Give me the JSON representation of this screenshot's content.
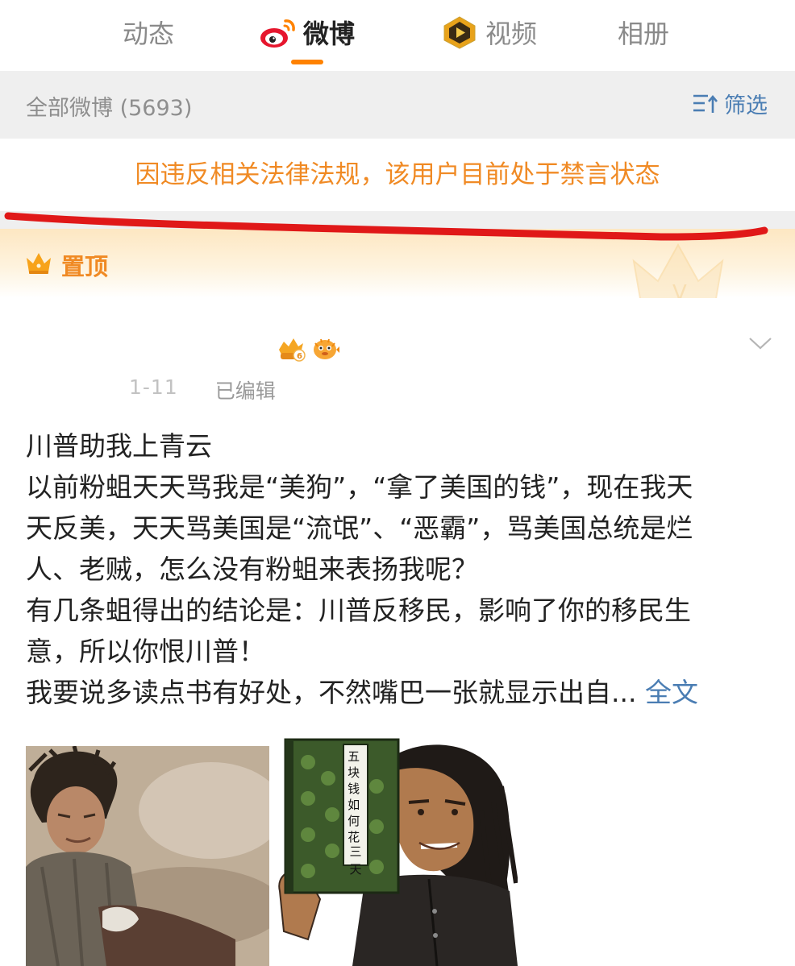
{
  "tabs": [
    {
      "label": "动态",
      "icon": ""
    },
    {
      "label": "微博",
      "icon": "weibo-logo-icon",
      "active": true
    },
    {
      "label": "视频",
      "icon": "video-play-icon"
    },
    {
      "label": "相册",
      "icon": ""
    }
  ],
  "filter_bar": {
    "count_text": "全部微博 (5693)",
    "filter_label": "筛选",
    "filter_icon": "sort-filter-icon"
  },
  "ban_notice": {
    "text": "因违反相关法律法规，该用户目前处于禁言状态"
  },
  "pinned": {
    "label": "置顶",
    "icon": "crown-icon"
  },
  "post": {
    "badges": [
      "vip-level-6-badge-icon",
      "pufferfish-badge-icon"
    ],
    "date": "1-11",
    "edited": "已编辑",
    "lines": [
      "川普助我上青云",
      "以前粉蛆天天骂我是“美狗”，“拿了美国的钱”，现在我天",
      "天反美，天天骂美国是“流氓”、“恶霸”，骂美国总统是烂",
      "人、老贼，怎么没有粉蛆来表扬我呢？",
      "有几条蛆得出的结论是：川普反移民，影响了你的移民生",
      "意，所以你恨川普！"
    ],
    "last_line": "我要说多读点书有好处，不然嘴巴一张就显示出自...",
    "expand_label": "全文",
    "images": [
      {
        "name": "photo-disheveled-man"
      },
      {
        "name": "cartoon-man-holding-book",
        "book_title": "五块钱如何花三天"
      }
    ]
  },
  "colors": {
    "accent": "#ff8200",
    "ban_text": "#f08a24",
    "link": "#4a7db3",
    "annotation_red": "#e01818"
  }
}
